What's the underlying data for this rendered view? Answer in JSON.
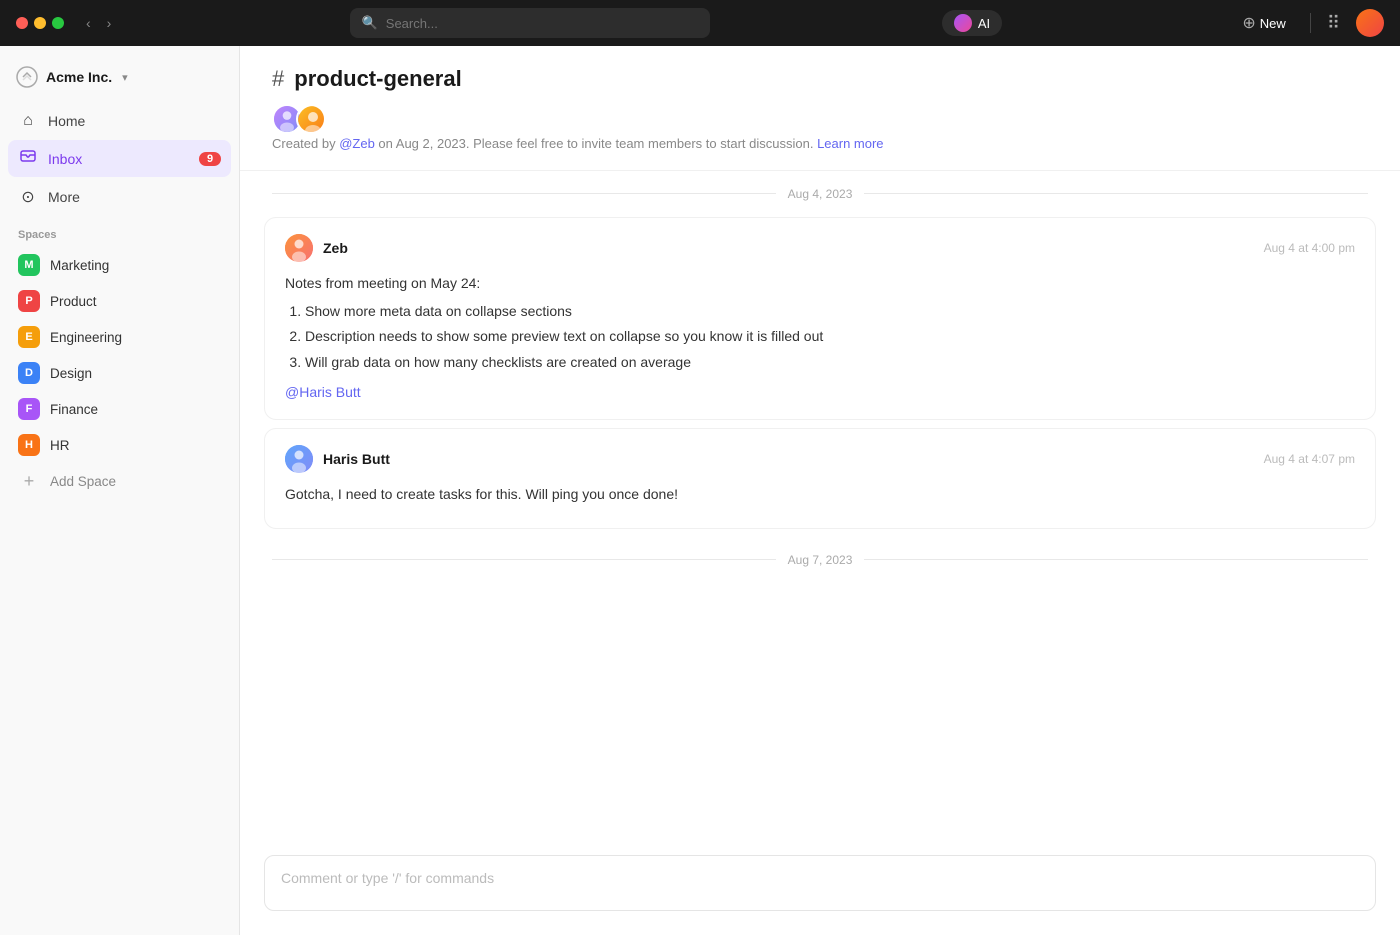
{
  "topbar": {
    "search_placeholder": "Search...",
    "ai_label": "AI",
    "new_label": "New"
  },
  "sidebar": {
    "brand": {
      "name": "Acme Inc.",
      "chevron": "▾"
    },
    "nav": [
      {
        "id": "home",
        "label": "Home",
        "icon": "🏠"
      },
      {
        "id": "inbox",
        "label": "Inbox",
        "icon": "📥",
        "badge": "9"
      },
      {
        "id": "more",
        "label": "More",
        "icon": "⊙"
      }
    ],
    "spaces_title": "Spaces",
    "spaces": [
      {
        "id": "marketing",
        "label": "Marketing",
        "initial": "M",
        "color": "#22c55e"
      },
      {
        "id": "product",
        "label": "Product",
        "initial": "P",
        "color": "#ef4444"
      },
      {
        "id": "engineering",
        "label": "Engineering",
        "initial": "E",
        "color": "#f59e0b"
      },
      {
        "id": "design",
        "label": "Design",
        "initial": "D",
        "color": "#3b82f6"
      },
      {
        "id": "finance",
        "label": "Finance",
        "initial": "F",
        "color": "#a855f7"
      },
      {
        "id": "hr",
        "label": "HR",
        "initial": "H",
        "color": "#f97316"
      }
    ],
    "add_space_label": "Add Space"
  },
  "channel": {
    "name": "product-general",
    "created_by": "@Zeb",
    "created_date": "Aug 2, 2023",
    "description_prefix": "Created by ",
    "description_middle": " on Aug 2, 2023. Please feel free to invite team members to start discussion. ",
    "learn_more": "Learn more"
  },
  "messages": [
    {
      "date_divider": "Aug 4, 2023",
      "messages": [
        {
          "id": "msg1",
          "author": "Zeb",
          "avatar_class": "message-avatar-zeb",
          "time": "Aug 4 at 4:00 pm",
          "body_intro": "Notes from meeting on May 24:",
          "list_items": [
            "Show more meta data on collapse sections",
            "Description needs to show some preview text on collapse so you know it is filled out",
            "Will grab data on how many checklists are created on average"
          ],
          "mention": "@Haris Butt"
        },
        {
          "id": "msg2",
          "author": "Haris Butt",
          "avatar_class": "message-avatar-haris",
          "time": "Aug 4 at 4:07 pm",
          "body_text": "Gotcha, I need to create tasks for this. Will ping you once done!"
        }
      ]
    },
    {
      "date_divider": "Aug 7, 2023",
      "messages": []
    }
  ],
  "comment_input": {
    "placeholder": "Comment or type '/' for commands"
  }
}
